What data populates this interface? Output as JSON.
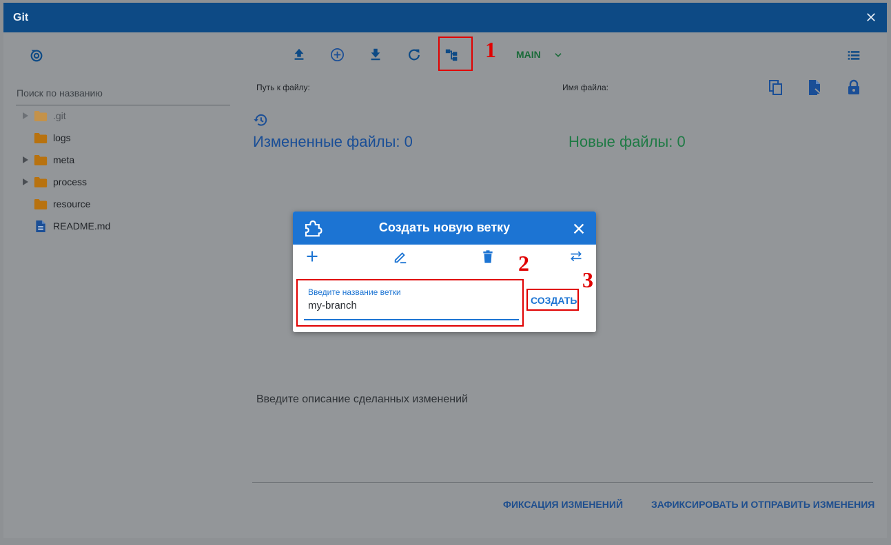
{
  "window": {
    "title": "Git"
  },
  "sidebar": {
    "search_placeholder": "Поиск по названию",
    "items": [
      {
        "label": ".git",
        "type": "folder",
        "expandable": true,
        "dimmed": true
      },
      {
        "label": "logs",
        "type": "folder",
        "expandable": false
      },
      {
        "label": "meta",
        "type": "folder",
        "expandable": true
      },
      {
        "label": "process",
        "type": "folder",
        "expandable": true
      },
      {
        "label": "resource",
        "type": "folder",
        "expandable": false
      },
      {
        "label": "README.md",
        "type": "file",
        "expandable": false
      }
    ]
  },
  "toolbar": {
    "icons": [
      "upload-icon",
      "add-circle-icon",
      "download-icon",
      "refresh-icon",
      "branch-tree-icon",
      "list-icon"
    ],
    "branch": "MAIN"
  },
  "file_info": {
    "path_label": "Путь к файлу:",
    "name_label": "Имя файла:"
  },
  "main": {
    "changed_files": "Измененные файлы: 0",
    "new_files": "Новые файлы: 0",
    "description_placeholder": "Введите описание сделанных изменений"
  },
  "footer": {
    "commit": "ФИКСАЦИЯ ИЗМЕНЕНИЙ",
    "commit_push": "ЗАФИКСИРОВАТЬ И ОТПРАВИТЬ ИЗМЕНЕНИЯ"
  },
  "dialog": {
    "title": "Создать новую ветку",
    "field_label": "Введите название ветки",
    "field_value": "my-branch",
    "create_label": "СОЗДАТЬ"
  },
  "annotations": {
    "step1": "1",
    "step2": "2",
    "step3": "3"
  },
  "colors": {
    "titlebar": "#0d4a85",
    "dialog_header": "#1c74d3",
    "changed_files": "#1a4e96",
    "new_files": "#1f7a45",
    "highlight": "#e00000"
  }
}
